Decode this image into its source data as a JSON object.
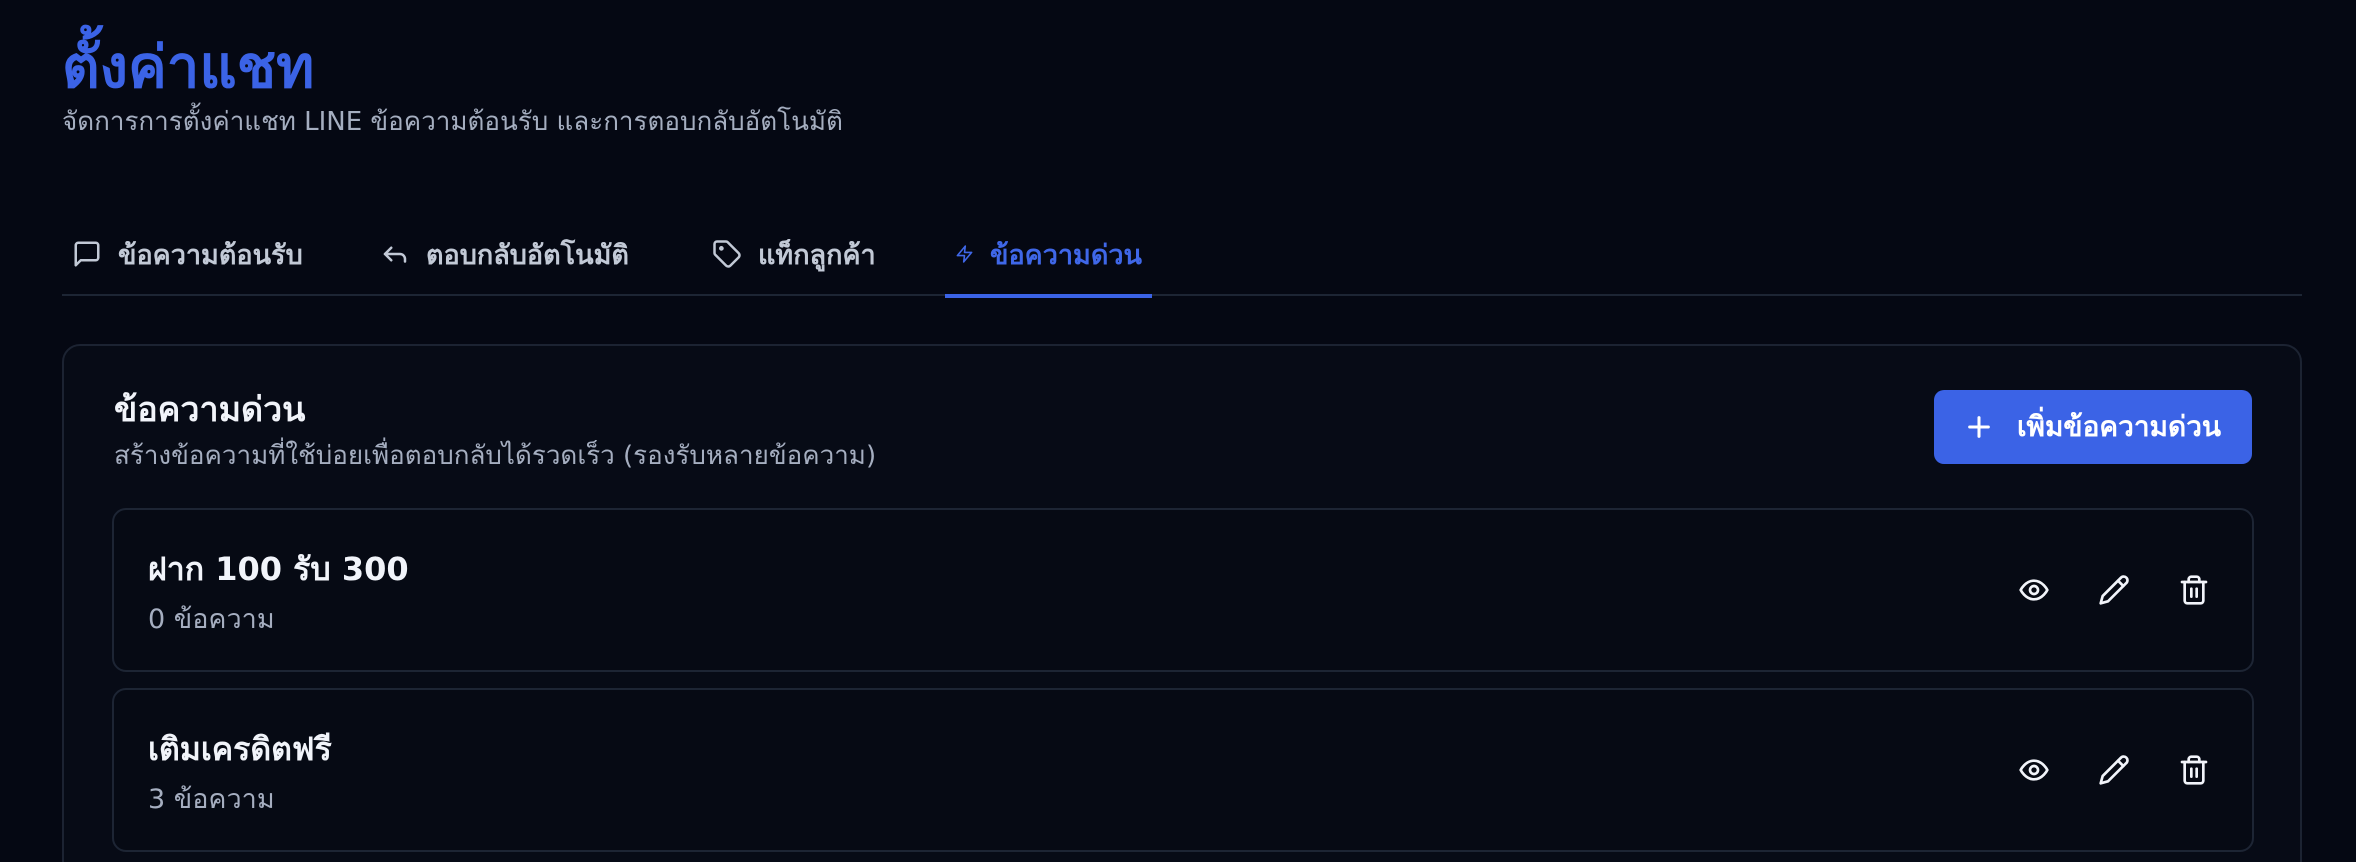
{
  "header": {
    "title": "ตั้งค่าแชท",
    "subtitle": "จัดการการตั้งค่าแชท LINE ข้อความต้อนรับ และการตอบกลับอัตโนมัติ"
  },
  "tabs": [
    {
      "label": "ข้อความต้อนรับ",
      "icon": "message-square-icon",
      "active": false
    },
    {
      "label": "ตอบกลับอัตโนมัติ",
      "icon": "reply-icon",
      "active": false
    },
    {
      "label": "แท็กลูกค้า",
      "icon": "tag-icon",
      "active": false
    },
    {
      "label": "ข้อความด่วน",
      "icon": "zap-icon",
      "active": true
    }
  ],
  "quick_messages": {
    "title": "ข้อความด่วน",
    "description": "สร้างข้อความที่ใช้บ่อยเพื่อตอบกลับได้รวดเร็ว (รองรับหลายข้อความ)",
    "add_button_label": "เพิ่มข้อความด่วน",
    "items": [
      {
        "title": "ฝาก 100 รับ 300",
        "count": "0 ข้อความ"
      },
      {
        "title": "เติมเครดิตฟรี",
        "count": "3 ข้อความ"
      }
    ]
  },
  "colors": {
    "background": "#050813",
    "accent": "#3b63e6",
    "border": "#1d2534",
    "text_muted": "#a5aec0"
  }
}
